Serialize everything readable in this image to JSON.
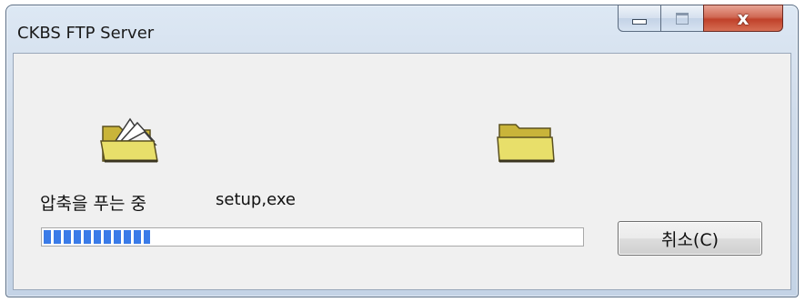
{
  "window": {
    "title": "CKBS FTP Server",
    "controls": {
      "minimize_icon": "minimize-icon",
      "maximize_icon": "maximize-icon",
      "close_icon": "close-icon",
      "close_glyph": "x"
    }
  },
  "dialog": {
    "status_text": "압축을 푸는 중",
    "file_name": "setup,exe",
    "source_icon": "open-folder-with-documents-icon",
    "destination_icon": "folder-icon",
    "progress_fraction": 0.2,
    "cancel_label": "취소(C)"
  },
  "colors": {
    "progress": "#3a7be8",
    "close_button": "#c0412a"
  }
}
